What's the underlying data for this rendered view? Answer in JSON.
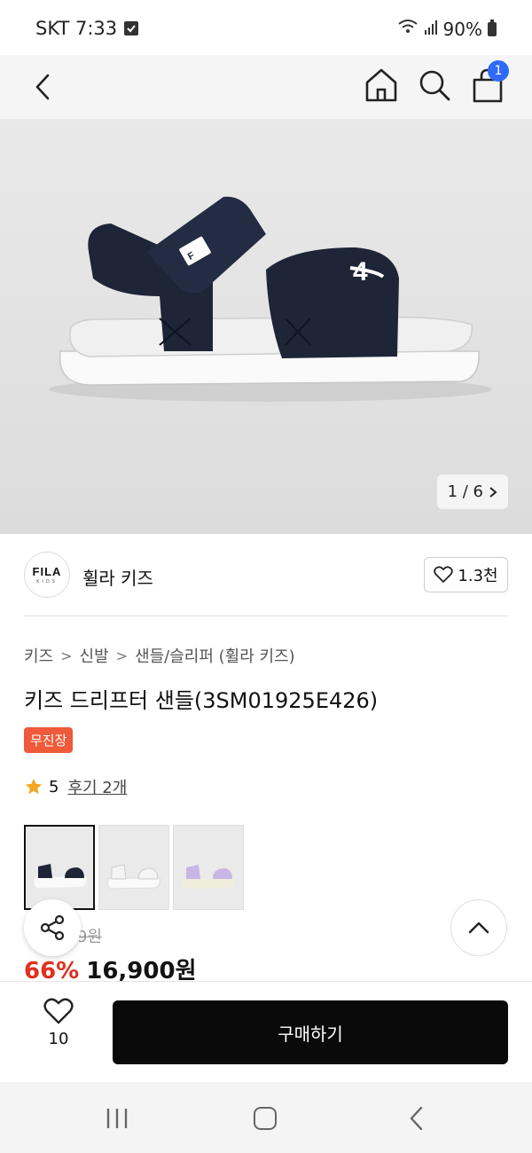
{
  "status_bar": {
    "carrier_time": "SKT 7:33",
    "battery": "90%"
  },
  "header": {
    "cart_count": "1"
  },
  "gallery": {
    "counter": "1 / 6"
  },
  "brand": {
    "logo_main": "FILA",
    "logo_sub": "KIDS",
    "name": "휠라 키즈",
    "likes": "1.3천"
  },
  "breadcrumb": [
    "키즈",
    "신발",
    "샌들/슬리퍼 (휠라 키즈)"
  ],
  "product": {
    "title": "키즈 드리프터 샌들(3SM01925E426)",
    "badge": "무진장",
    "rating": "5",
    "reviews": "후기 2개",
    "original_price_partial": "9원",
    "discount": "66%",
    "price": "16,900원"
  },
  "bottom_bar": {
    "wish_count": "10",
    "buy_label": "구매하기"
  },
  "colors": {
    "accent_blue": "#2f6bf6",
    "discount_red": "#e0301e",
    "badge_orange": "#ef5a3a",
    "buy_button": "#0a0a0a"
  }
}
